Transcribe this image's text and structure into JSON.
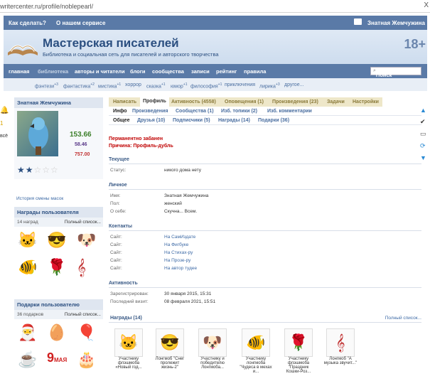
{
  "browser": {
    "url": "writercenter.ru/profile/noblepearl/",
    "close": "X"
  },
  "topbar": {
    "how": "Как сделать?",
    "about": "О нашем сервисе",
    "user": "Знатная Жемчужина"
  },
  "header": {
    "title": "Мастерская писателей",
    "subtitle": "Библиотека и социальная сеть для писателей и авторского творчества",
    "age": "18+"
  },
  "nav": [
    "главная",
    "библиотека",
    "авторы и читатели",
    "блоги",
    "сообщества",
    "записи",
    "рейтинг",
    "правила"
  ],
  "search_placeholder": "Поиск",
  "genres": [
    {
      "name": "фэнтези",
      "sup": "+3"
    },
    {
      "name": "фантастика",
      "sup": "+2"
    },
    {
      "name": "мистика",
      "sup": "+1"
    },
    {
      "name": "хоррор",
      "sup": ""
    },
    {
      "name": "сказка",
      "sup": "+1"
    },
    {
      "name": "юмор",
      "sup": "+1"
    },
    {
      "name": "философия",
      "sup": "+1"
    },
    {
      "name": "приключения",
      "sup": ""
    },
    {
      "name": "лирика",
      "sup": "+3"
    },
    {
      "name": "другое...",
      "sup": ""
    }
  ],
  "profile": {
    "name": "Знатная Жемчужина",
    "score": "153.66",
    "s2": "58.46",
    "s3": "757.00",
    "mask_history": "История смены масок"
  },
  "awards_box": {
    "title": "Награды пользователя",
    "count": "14 наград",
    "full": "Полный список..."
  },
  "gifts_box": {
    "title": "Подарки пользователю",
    "count": "36 подарков",
    "full": "Полный список..."
  },
  "rail": {
    "bell_count": "1",
    "left_text": "всё"
  },
  "tabs1": [
    "Написать",
    "Профиль",
    "Активность (4558)",
    "Оповещения (1)",
    "Произведения (23)",
    "Задачи",
    "Настройки"
  ],
  "tabs2": [
    "Инфо",
    "Произведения",
    "Сообщества (1)",
    "Изб. топики (2)",
    "Изб. комментарии"
  ],
  "tabs3": [
    "Общее",
    "Друзья (10)",
    "Подписчики (5)",
    "Награды (14)",
    "Подарки (36)"
  ],
  "ban": {
    "line1": "Перманентно забанен",
    "line2": "Причина: Профиль-дубль"
  },
  "current": {
    "title": "Текущее",
    "status_k": "Статус:",
    "status_v": "никого дома нету"
  },
  "personal": {
    "title": "Личное",
    "name_k": "Имя:",
    "name_v": "Знатная Жемчужина",
    "sex_k": "Пол:",
    "sex_v": "женский",
    "about_k": "О себе:",
    "about_v": "Скучна... Всем."
  },
  "contacts": {
    "title": "Контакты",
    "items": [
      {
        "k": "Сайт:",
        "v": "На СамИздате"
      },
      {
        "k": "Сайт:",
        "v": "На Фигбуке"
      },
      {
        "k": "Сайт:",
        "v": "На Стихах-ру"
      },
      {
        "k": "Сайт:",
        "v": "На Прозе-ру"
      },
      {
        "k": "Сайт:",
        "v": "На автор тудее"
      }
    ]
  },
  "activity": {
    "title": "Активность",
    "reg_k": "Зарегистрирован:",
    "reg_v": "30 января 2015, 15:31",
    "last_k": "Последний визит:",
    "last_v": "08 февраля 2021, 15:51"
  },
  "awards": {
    "title": "Награды (14)",
    "full": "Полный список...",
    "items": [
      "Участнику флэшмоба «Новый год...",
      "Лонгмоб \"Снег пролежит жизнь-2\"",
      "Участнику и победителю Лонгмоба...",
      "Участнику лонгмоба \"Чудеса в мехах и...",
      "Участнику флэшмоба \"Праздник Кошки-Роз...",
      "Лонгмоб \"А музыка звучит...\""
    ]
  }
}
